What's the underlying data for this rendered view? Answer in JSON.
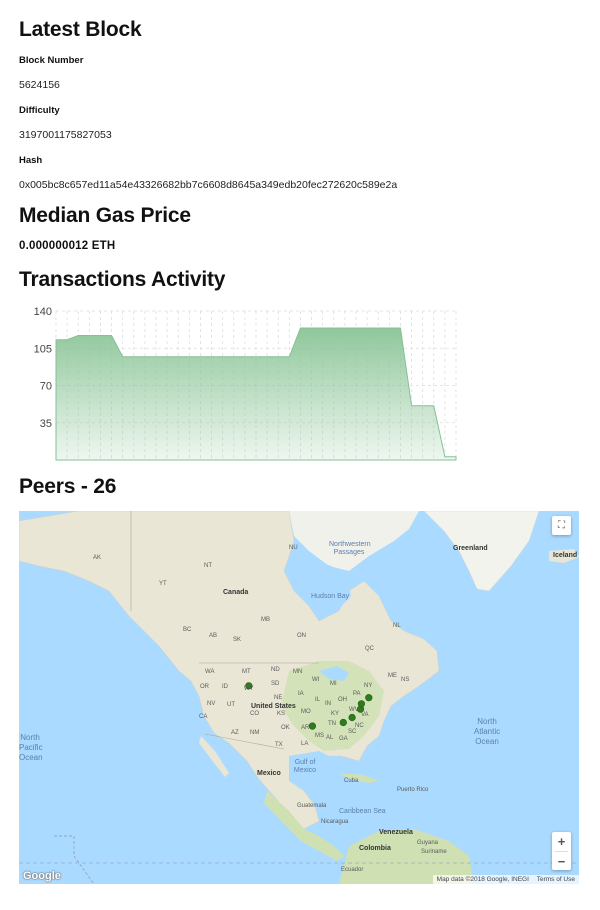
{
  "latest_block": {
    "title": "Latest Block",
    "block_number_label": "Block Number",
    "block_number": "5624156",
    "difficulty_label": "Difficulty",
    "difficulty": "3197001175827053",
    "hash_label": "Hash",
    "hash": "0x005bc8c657ed11a54e43326682bb7c6608d8645a349edb20fec272620c589e2a"
  },
  "gas": {
    "title": "Median Gas Price",
    "value": "0.000000012 ETH"
  },
  "transactions": {
    "title": "Transactions Activity"
  },
  "chart_data": {
    "type": "area",
    "title": "",
    "xlabel": "",
    "ylabel": "",
    "ylim": [
      0,
      140
    ],
    "yticks": [
      35,
      70,
      105,
      140
    ],
    "grid": true,
    "legend": "none",
    "color": "#8fc79b",
    "x": [
      0,
      1,
      2,
      3,
      4,
      5,
      6,
      7,
      8,
      9,
      10,
      11,
      12,
      13,
      14,
      15,
      16,
      17,
      18,
      19,
      20,
      21,
      22,
      23,
      24,
      25,
      26,
      27,
      28,
      29,
      30,
      31,
      32,
      33,
      34,
      35,
      36
    ],
    "values": [
      113,
      113,
      117,
      117,
      117,
      117,
      97,
      97,
      97,
      97,
      97,
      97,
      97,
      97,
      97,
      97,
      97,
      97,
      97,
      97,
      97,
      97,
      124,
      124,
      124,
      124,
      124,
      124,
      124,
      124,
      124,
      124,
      51,
      51,
      51,
      3,
      3
    ]
  },
  "peers": {
    "title": "Peers - 26",
    "map_colors": {
      "water": "#aadaff",
      "land": "#e8e5d5",
      "green": "#c8dfb0",
      "ice": "#f4f4f0",
      "marker": "#2e7d1a"
    },
    "labels": {
      "canada": "Canada",
      "united_states": "United States",
      "mexico": "Mexico",
      "greenland": "Greenland",
      "iceland": "Iceland",
      "hudson_bay": "Hudson Bay",
      "northwest_passages": "Northwestern Passages",
      "north_atlantic": "North Atlantic Ocean",
      "north_pacific": "North Pacific Ocean",
      "gulf_mexico": "Gulf of Mexico",
      "caribbean": "Caribbean Sea",
      "cuba": "Cuba",
      "puerto_rico": "Puerto Rico",
      "venezuela": "Venezuela",
      "colombia": "Colombia",
      "guatemala": "Guatemala",
      "nicaragua": "Nicaragua",
      "guyana": "Guyana",
      "suriname": "Suriname",
      "ecuador": "Ecuador",
      "ak": "AK",
      "nt": "NT",
      "nu": "NU",
      "yt": "YT",
      "bc": "BC",
      "ab": "AB",
      "sk": "SK",
      "mb": "MB",
      "on": "ON",
      "qc": "QC",
      "nl": "NL",
      "wa": "WA",
      "or": "OR",
      "id": "ID",
      "mt": "MT",
      "nd": "ND",
      "nv": "NV",
      "wy": "WY",
      "sd": "SD",
      "ca": "CA",
      "ut": "UT",
      "co": "CO",
      "ne": "NE",
      "ks": "KS",
      "az": "AZ",
      "nm": "NM",
      "ok": "OK",
      "tx": "TX",
      "mn": "MN",
      "ia": "IA",
      "mo": "MO",
      "ar": "AR",
      "la": "LA",
      "wi": "WI",
      "il": "IL",
      "ms": "MS",
      "mi": "MI",
      "in": "IN",
      "oh": "OH",
      "ky": "KY",
      "tn": "TN",
      "al": "AL",
      "ga": "GA",
      "pa": "PA",
      "wv": "WV",
      "va": "VA",
      "nc": "NC",
      "sc": "SC",
      "ny": "NY",
      "me": "ME",
      "ns": "NS"
    },
    "markers": [
      {
        "lat": 44.0,
        "lon": -123.0
      },
      {
        "lat": 32.8,
        "lon": -97.0
      },
      {
        "lat": 33.8,
        "lon": -84.4
      },
      {
        "lat": 35.2,
        "lon": -80.8
      },
      {
        "lat": 37.5,
        "lon": -77.4
      },
      {
        "lat": 39.0,
        "lon": -77.0
      },
      {
        "lat": 40.7,
        "lon": -74.0
      }
    ],
    "fullscreen_icon": "fullscreen-icon",
    "zoom_in": "+",
    "zoom_out": "−",
    "google": "Google",
    "attribution": "Map data ©2018 Google, INEGI",
    "terms": "Terms of Use"
  }
}
